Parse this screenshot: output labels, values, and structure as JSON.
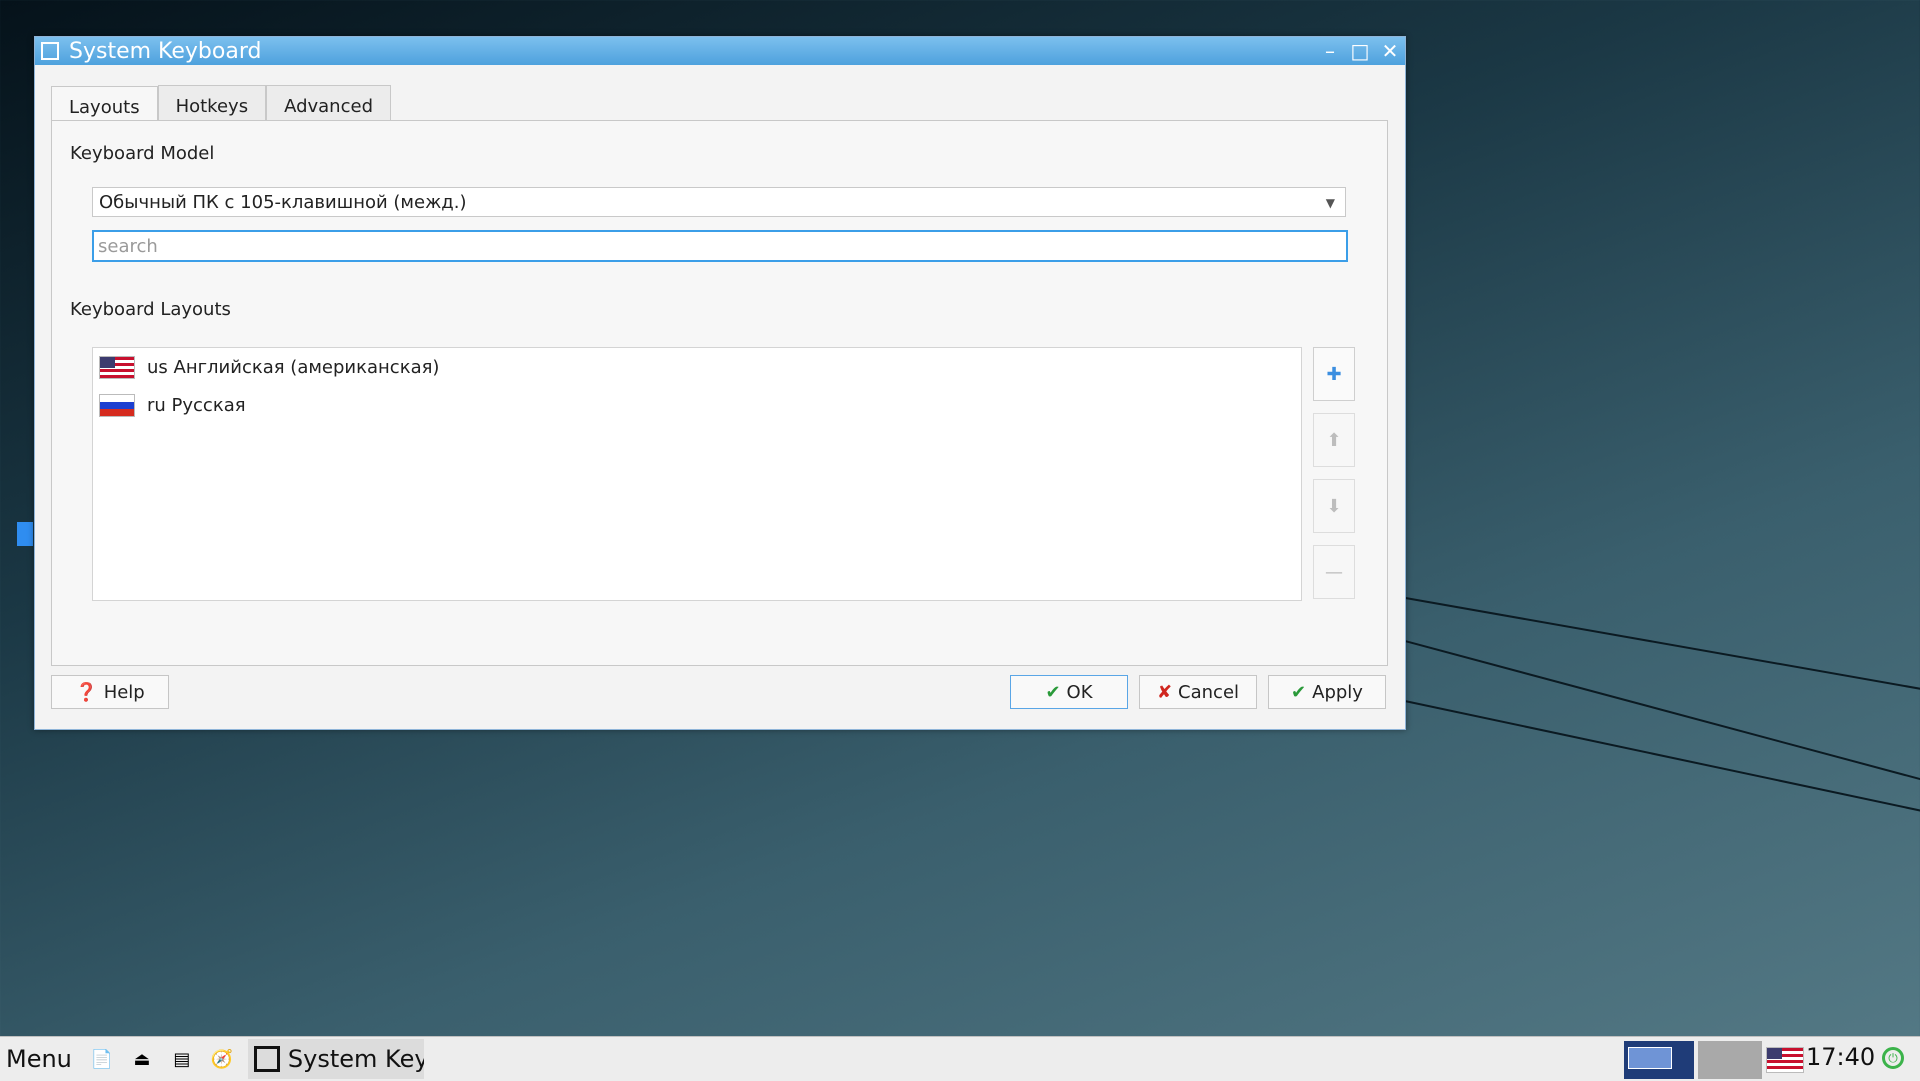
{
  "window": {
    "title": "System Keyboard",
    "minimize_glyph": "–",
    "maximize_glyph": "□",
    "close_glyph": "✕"
  },
  "tabs": [
    {
      "label": "Layouts",
      "active": true
    },
    {
      "label": "Hotkeys",
      "active": false
    },
    {
      "label": "Advanced",
      "active": false
    }
  ],
  "keyboard_model": {
    "section_label": "Keyboard Model",
    "selected": "Обычный ПК с 105-клавишной (межд.)",
    "search_placeholder": "search",
    "search_value": ""
  },
  "keyboard_layouts": {
    "section_label": "Keyboard Layouts",
    "items": [
      {
        "label": "us Английская (американская)",
        "flag": "us-flag-icon"
      },
      {
        "label": "ru Русская",
        "flag": "ru-flag-icon"
      }
    ],
    "side_buttons": [
      {
        "name": "add-layout-button",
        "icon": "plus-icon",
        "glyph": "✚",
        "enabled": true
      },
      {
        "name": "move-up-button",
        "icon": "arrow-up-icon",
        "glyph": "⬆",
        "enabled": false
      },
      {
        "name": "move-down-button",
        "icon": "arrow-down-icon",
        "glyph": "⬇",
        "enabled": false
      },
      {
        "name": "remove-layout-button",
        "icon": "minus-icon",
        "glyph": "—",
        "enabled": false
      }
    ]
  },
  "buttons": {
    "help": "Help",
    "ok": "OK",
    "cancel": "Cancel",
    "apply": "Apply"
  },
  "taskbar": {
    "menu_label": "Menu",
    "task_label": "System Keyb",
    "clock": "17:40"
  },
  "colors": {
    "accent": "#3b9ee8",
    "titlebar": "#5aaae3"
  }
}
